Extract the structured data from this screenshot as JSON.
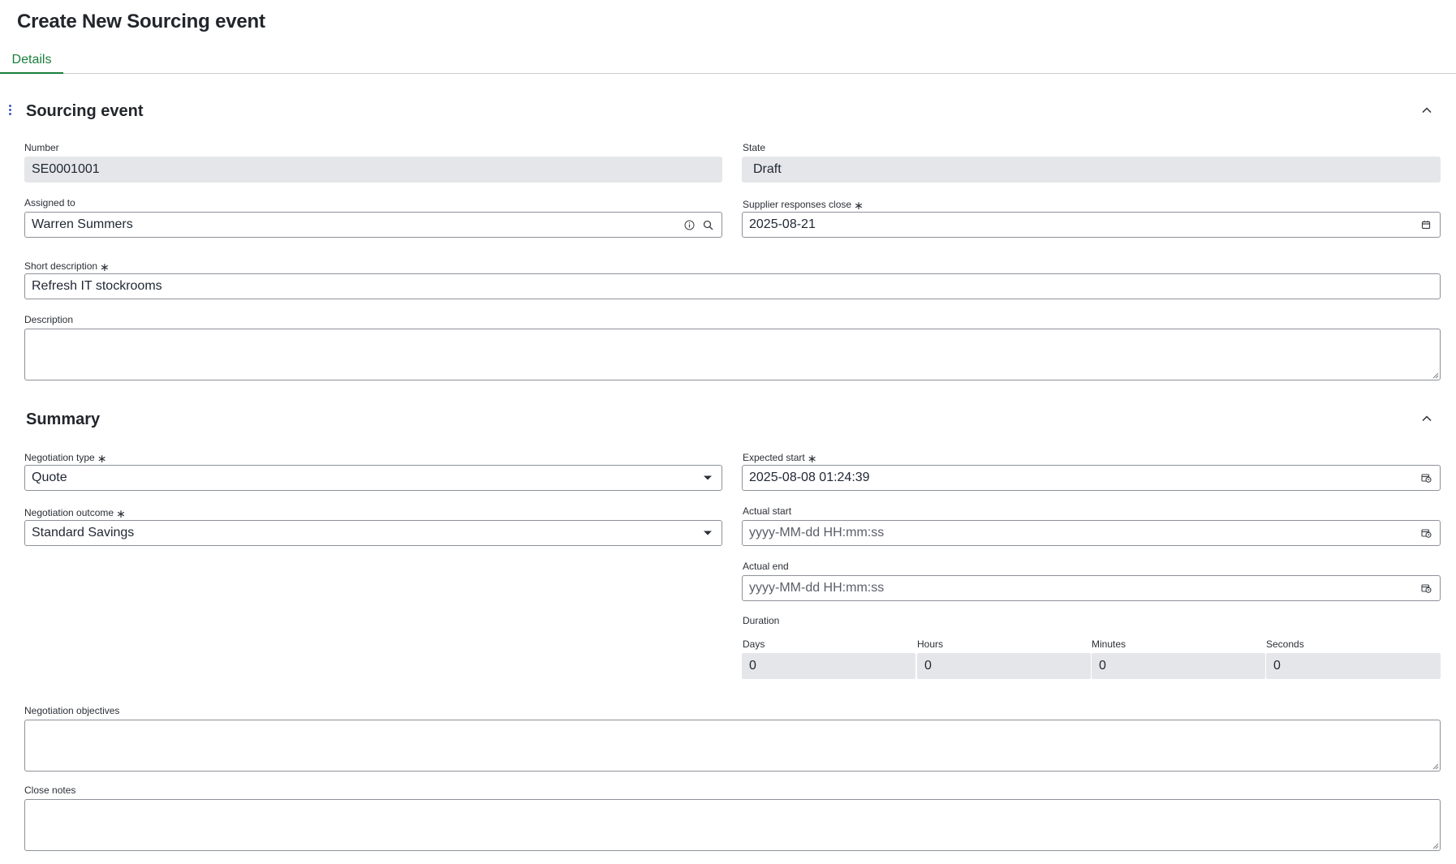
{
  "page": {
    "title": "Create New Sourcing event"
  },
  "tabs": [
    {
      "label": "Details",
      "active": true
    }
  ],
  "sections": {
    "sourcing_event": {
      "title": "Sourcing event"
    },
    "summary": {
      "title": "Summary"
    }
  },
  "fields": {
    "number": {
      "label": "Number",
      "value": "SE0001001"
    },
    "state": {
      "label": "State",
      "value": "Draft"
    },
    "assigned_to": {
      "label": "Assigned to",
      "value": "Warren Summers"
    },
    "supplier_responses_close": {
      "label": "Supplier responses close",
      "value": "2025-08-21",
      "required": true
    },
    "short_description": {
      "label": "Short description",
      "value": "Refresh IT stockrooms",
      "required": true
    },
    "description": {
      "label": "Description",
      "value": ""
    },
    "negotiation_type": {
      "label": "Negotiation type",
      "value": "Quote",
      "required": true
    },
    "negotiation_outcome": {
      "label": "Negotiation outcome",
      "value": "Standard Savings",
      "required": true
    },
    "expected_start": {
      "label": "Expected start",
      "value": "2025-08-08 01:24:39",
      "required": true
    },
    "actual_start": {
      "label": "Actual start",
      "placeholder": "yyyy-MM-dd HH:mm:ss"
    },
    "actual_end": {
      "label": "Actual end",
      "placeholder": "yyyy-MM-dd HH:mm:ss"
    },
    "duration": {
      "label": "Duration",
      "days": {
        "label": "Days",
        "value": "0"
      },
      "hours": {
        "label": "Hours",
        "value": "0"
      },
      "minutes": {
        "label": "Minutes",
        "value": "0"
      },
      "seconds": {
        "label": "Seconds",
        "value": "0"
      }
    },
    "negotiation_objectives": {
      "label": "Negotiation objectives",
      "value": ""
    },
    "close_notes": {
      "label": "Close notes",
      "value": ""
    }
  },
  "required_marker": "∗",
  "colors": {
    "accent": "#1a7f3c",
    "handle": "#3b58c4",
    "readonly_bg": "#e5e6e9",
    "border": "#8d9198"
  },
  "icons": [
    "drag-handle-icon",
    "chevron-up-icon",
    "info-icon",
    "search-icon",
    "calendar-icon",
    "calendar-clock-icon",
    "caret-down-icon",
    "resize-handle-icon"
  ]
}
